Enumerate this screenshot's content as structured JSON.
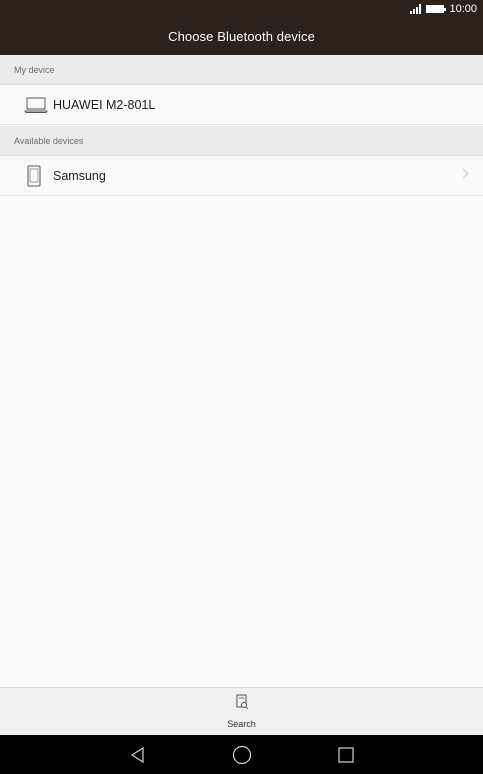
{
  "status_bar": {
    "time": "10:00",
    "signal_icon": "signal-icon",
    "battery_icon": "battery-icon"
  },
  "header": {
    "title": "Choose Bluetooth device"
  },
  "my_device": {
    "section_label": "My device",
    "device": {
      "name": "HUAWEI M2-801L",
      "icon": "laptop-icon"
    }
  },
  "available_devices": {
    "section_label": "Available devices",
    "devices": [
      {
        "name": "Samsung",
        "icon": "phone-icon"
      }
    ]
  },
  "bottom_bar": {
    "search_label": "Search",
    "search_icon": "search-device-icon"
  },
  "nav_bar": {
    "back_icon": "back-icon",
    "home_icon": "home-icon",
    "recents_icon": "recents-icon"
  }
}
